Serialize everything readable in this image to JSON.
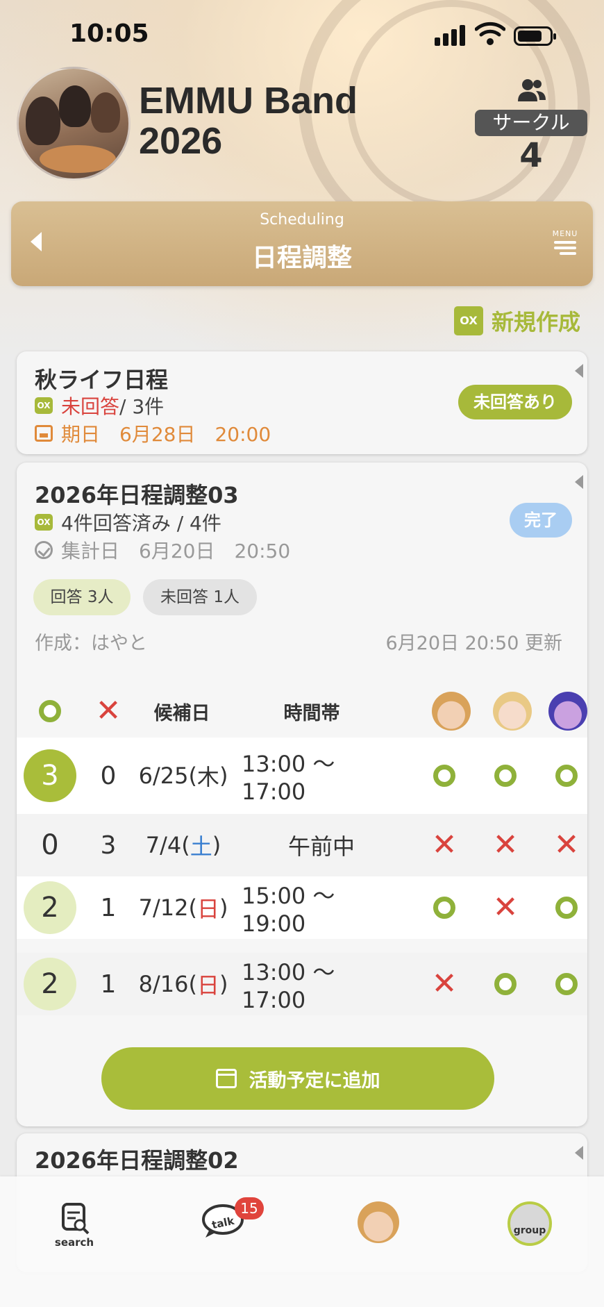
{
  "status_bar": {
    "time": "10:05"
  },
  "header": {
    "group_name_line1": "EMMU Band",
    "group_name_line2": "2026",
    "circle_label": "サークル",
    "circle_count": "4"
  },
  "nav": {
    "subtitle": "Scheduling",
    "title": "日程調整",
    "menu_label": "MENU"
  },
  "actions": {
    "new_create_label": "新規作成",
    "ox_icon_text": "OX"
  },
  "cards": [
    {
      "title": "秋ライフ日程",
      "answer_status": "未回答",
      "answer_suffix": " / 3件",
      "date_label": "期日",
      "date_value": "6月28日　20:00",
      "badge": "未回答あり",
      "badge_color": "#a7b93a"
    },
    {
      "title": "2026年日程調整03",
      "answer_line": "4件回答済み / 4件",
      "date_label": "集計日",
      "date_value": "6月20日　20:50",
      "badge": "完了",
      "badge_color": "#a9cdf2",
      "chip_answered": "回答 3人",
      "chip_unanswered": "未回答 1人",
      "author": "作成：はやと",
      "updated": "6月20日 20:50 更新",
      "table": {
        "headers": {
          "date": "候補日",
          "time": "時間帯"
        },
        "rows": [
          {
            "ok": "3",
            "ng": "0",
            "date_pre": "6/25(",
            "day": "木",
            "date_post": ")",
            "time": "13:00 〜 17:00",
            "marks": [
              "o",
              "o",
              "o"
            ]
          },
          {
            "ok": "0",
            "ng": "3",
            "date_pre": "7/4(",
            "day": "土",
            "date_post": ")",
            "time": "午前中",
            "marks": [
              "x",
              "x",
              "x"
            ]
          },
          {
            "ok": "2",
            "ng": "1",
            "date_pre": "7/12(",
            "day": "日",
            "date_post": ")",
            "time": "15:00 〜 19:00",
            "marks": [
              "o",
              "x",
              "o"
            ]
          },
          {
            "ok": "2",
            "ng": "1",
            "date_pre": "8/16(",
            "day": "日",
            "date_post": ")",
            "time": "13:00 〜 17:00",
            "marks": [
              "x",
              "o",
              "o"
            ]
          }
        ]
      },
      "add_button": "活動予定に追加"
    },
    {
      "title": "2026年日程調整02"
    }
  ],
  "colors": {
    "accent": "#a9bd3a",
    "ok": "#8fb13a",
    "ng": "#d9433d",
    "sat": "#3a7fd0",
    "sun": "#d9433d"
  },
  "tabbar": {
    "search_label": "search",
    "talk_label": "talk",
    "talk_badge": "15",
    "group_label": "group"
  }
}
